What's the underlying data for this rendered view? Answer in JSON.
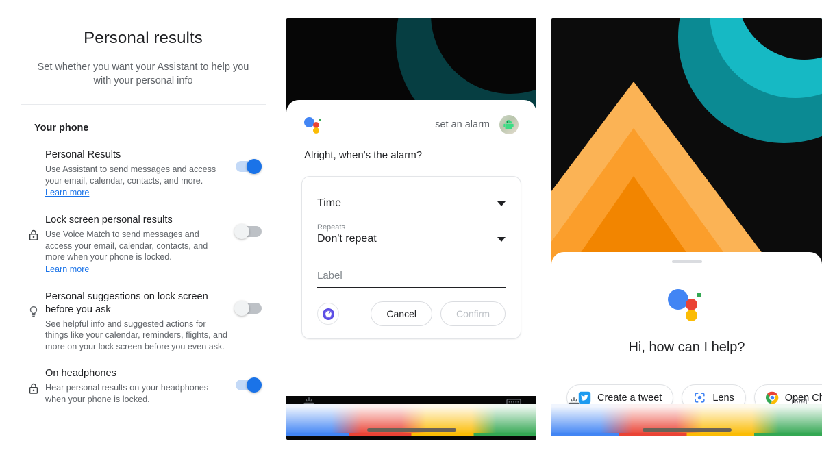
{
  "settings": {
    "title": "Personal results",
    "subtitle": "Set whether you want your Assistant to help you with your personal info",
    "section_header": "Your phone",
    "rows": [
      {
        "icon": "none",
        "title": "Personal Results",
        "description": "Use Assistant to send messages and access your email, calendar, contacts, and more.",
        "link": "Learn more",
        "toggle": "on"
      },
      {
        "icon": "lock-icon",
        "title": "Lock screen personal results",
        "description": "Use Voice Match to send messages and access your email, calendar, contacts, and more when your phone is locked.",
        "link": "Learn more",
        "toggle": "off"
      },
      {
        "icon": "lightbulb-icon",
        "title": "Personal suggestions on lock screen before you ask",
        "description": "See helpful info and suggested actions for things like your calendar, reminders, flights, and more on your lock screen before you even ask.",
        "link": "",
        "toggle": "off"
      },
      {
        "icon": "lock-icon",
        "title": "On headphones",
        "description": "Hear personal results on your headphones when your phone is locked.",
        "link": "",
        "toggle": "on"
      }
    ]
  },
  "alarm": {
    "query": "set an alarm",
    "reply": "Alright, when's the alarm?",
    "time_label": "Time",
    "repeats_caption": "Repeats",
    "repeats_value": "Don't repeat",
    "label_placeholder": "Label",
    "label_value": "",
    "cancel_label": "Cancel",
    "confirm_label": "Confirm",
    "app_icon": "clock-icon",
    "bottom_left_icon": "explore-icon",
    "bottom_right_icon": "keyboard-icon"
  },
  "home": {
    "greeting": "Hi, how can I help?",
    "chips": [
      {
        "icon": "twitter-icon",
        "label": "Create a tweet"
      },
      {
        "icon": "lens-icon",
        "label": "Lens"
      },
      {
        "icon": "chrome-icon",
        "label": "Open Chro"
      }
    ],
    "bottom_left_icon": "explore-icon",
    "bottom_right_icon": "keyboard-icon"
  },
  "colors": {
    "accent_blue": "#1a73e8",
    "link_blue": "#1a73e8",
    "toggle_off_track": "#bdc1c6",
    "google_blue": "#4285f4",
    "google_red": "#ea4335",
    "google_yellow": "#fbbc05",
    "google_green": "#34a853",
    "wallpaper_dark": "#0c0c0c",
    "wallpaper_orange": "#f98c00",
    "wallpaper_teal": "#0b8a93",
    "clock_purple": "#5c4ee5"
  }
}
